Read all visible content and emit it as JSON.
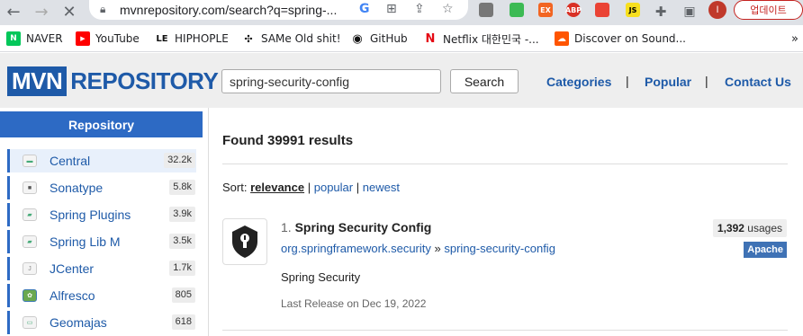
{
  "browser": {
    "url": "mvnrepository.com/search?q=spring-...",
    "update_label": "업데이트",
    "profile_initial": "I",
    "extensions": [
      "ext-gray",
      "ext-green",
      "EX",
      "ABP",
      "ext-red",
      "JS"
    ],
    "bookmarks": [
      {
        "label": "NAVER",
        "icon": "N"
      },
      {
        "label": "YouTube",
        "icon": "▶"
      },
      {
        "label": "HIPHOPLE",
        "icon": "LE"
      },
      {
        "label": "SAMe Old shit!",
        "icon": "✣"
      },
      {
        "label": "GitHub",
        "icon": "◉"
      },
      {
        "label": "Netflix 대한민국 -...",
        "icon": "N"
      },
      {
        "label": "Discover on Sound...",
        "icon": "☁"
      }
    ],
    "more_bookmarks": "»"
  },
  "site": {
    "logo_mvn": "MVN",
    "logo_repo": "REPOSITORY",
    "search_value": "spring-security-config",
    "search_button": "Search",
    "nav": [
      "Categories",
      "Popular",
      "Contact Us"
    ],
    "nav_sep": "|"
  },
  "sidebar": {
    "title": "Repository",
    "items": [
      {
        "name": "Central",
        "count": "32.2k"
      },
      {
        "name": "Sonatype",
        "count": "5.8k"
      },
      {
        "name": "Spring Plugins",
        "count": "3.9k"
      },
      {
        "name": "Spring Lib M",
        "count": "3.5k"
      },
      {
        "name": "JCenter",
        "count": "1.7k"
      },
      {
        "name": "Alfresco",
        "count": "805"
      },
      {
        "name": "Geomajas",
        "count": "618"
      }
    ]
  },
  "main": {
    "found": "Found 39991 results",
    "sort_label": "Sort:",
    "sort_current": "relevance",
    "sort_sep": "|",
    "sort_options": [
      "popular",
      "newest"
    ],
    "result": {
      "number": "1.",
      "title": "Spring Security Config",
      "group": "org.springframework.security",
      "arrow": "»",
      "artifact": "spring-security-config",
      "description": "Spring Security",
      "last_release": "Last Release on Dec 19, 2022",
      "usages_count": "1,392",
      "usages_label": "usages",
      "license": "Apache"
    }
  },
  "colors": {
    "brand": "#1e5aa8",
    "sidebar_title_bg": "#2d6ac4",
    "license_bg": "#3f72b5"
  }
}
